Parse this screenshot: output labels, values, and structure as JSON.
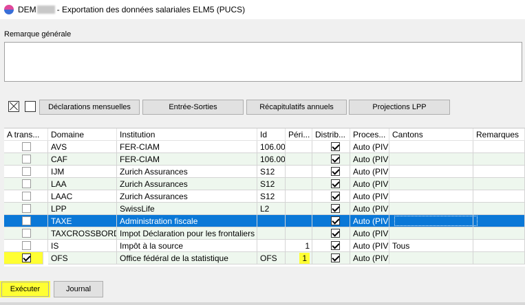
{
  "window": {
    "title_prefix": "DEM",
    "title_main": "- Exportation des données salariales ELM5 (PUCS)"
  },
  "remark": {
    "label": "Remarque générale",
    "value": ""
  },
  "toolbar": {
    "buttons": [
      "Déclarations mensuelles",
      "Entrée-Sorties",
      "Récapitulatifs annuels",
      "Projections LPP"
    ]
  },
  "table": {
    "headers": [
      "A trans...",
      "Domaine",
      "Institution",
      "Id",
      "Péri...",
      "Distrib...",
      "Proces...",
      "Cantons",
      "Remarques"
    ],
    "rows": [
      {
        "transfer": false,
        "domaine": "AVS",
        "institution": "FER-CIAM",
        "id": "106.00",
        "periode": "",
        "distrib": true,
        "process": "Auto (PIV",
        "cantons": "",
        "remarques": ""
      },
      {
        "transfer": false,
        "domaine": "CAF",
        "institution": "FER-CIAM",
        "id": "106.00",
        "periode": "",
        "distrib": true,
        "process": "Auto (PIV",
        "cantons": "",
        "remarques": ""
      },
      {
        "transfer": false,
        "domaine": "IJM",
        "institution": "Zurich Assurances",
        "id": "S12",
        "periode": "",
        "distrib": true,
        "process": "Auto (PIV",
        "cantons": "",
        "remarques": ""
      },
      {
        "transfer": false,
        "domaine": "LAA",
        "institution": "Zurich Assurances",
        "id": "S12",
        "periode": "",
        "distrib": true,
        "process": "Auto (PIV",
        "cantons": "",
        "remarques": ""
      },
      {
        "transfer": false,
        "domaine": "LAAC",
        "institution": "Zurich Assurances",
        "id": "S12",
        "periode": "",
        "distrib": true,
        "process": "Auto (PIV",
        "cantons": "",
        "remarques": ""
      },
      {
        "transfer": false,
        "domaine": "LPP",
        "institution": "SwissLife",
        "id": "L2",
        "periode": "",
        "distrib": true,
        "process": "Auto (PIV",
        "cantons": "",
        "remarques": ""
      },
      {
        "transfer": false,
        "domaine": "TAXE",
        "institution": "Administration fiscale",
        "id": "",
        "periode": "",
        "distrib": true,
        "process": "Auto (PIV",
        "cantons": "",
        "remarques": ""
      },
      {
        "transfer": false,
        "domaine": "TAXCROSSBORDER",
        "institution": "Impot Déclaration pour les frontaliers",
        "id": "",
        "periode": "",
        "distrib": true,
        "process": "Auto (PIV",
        "cantons": "",
        "remarques": ""
      },
      {
        "transfer": false,
        "domaine": "IS",
        "institution": "Impôt à la source",
        "id": "",
        "periode": "1",
        "distrib": true,
        "process": "Auto (PIV",
        "cantons": "Tous",
        "remarques": ""
      },
      {
        "transfer": true,
        "domaine": "OFS",
        "institution": "Office fédéral de la statistique",
        "id": "OFS",
        "periode": "1",
        "distrib": true,
        "process": "Auto (PIV",
        "cantons": "",
        "remarques": ""
      }
    ]
  },
  "actions": {
    "execute": "Exécuter",
    "journal": "Journal"
  },
  "colors": {
    "selection": "#0a78d7",
    "highlight": "#ffff33",
    "stripe": "#eef7ee"
  }
}
